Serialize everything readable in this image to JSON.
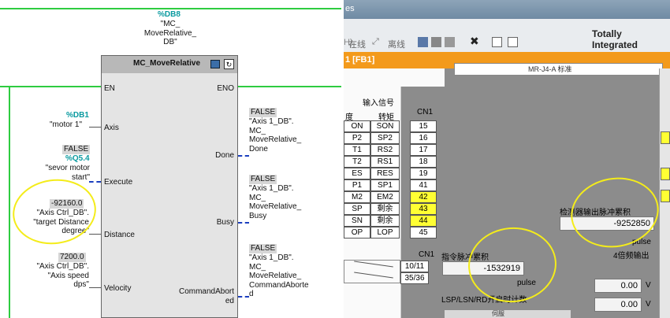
{
  "ladder": {
    "db_tag": "%DB8",
    "db_name": "\"MC_\nMoveRelative_\nDB\"",
    "block_title": "MC_MoveRelative",
    "pins": {
      "en": "EN",
      "eno": "ENO",
      "axis": "Axis",
      "execute": "Execute",
      "distance": "Distance",
      "velocity": "Velocity",
      "done": "Done",
      "busy": "Busy",
      "cmd_aborted": "CommandAbort\ned"
    },
    "axis_param": {
      "tag": "%DB1",
      "name": "\"motor 1\""
    },
    "execute_param": {
      "value": "FALSE",
      "tag": "%Q5.4",
      "name": "\"sevor motor\nstart\""
    },
    "distance_param": {
      "value": "-92160.0",
      "name": "\"Axis Ctrl_DB\".\n\"target Distance\ndegree\""
    },
    "velocity_param": {
      "value": "7200.0",
      "name": "\"Axis Ctrl_DB\".\n\"Axis speed\ndps\""
    },
    "done_out": {
      "value": "FALSE",
      "name": "\"Axis 1_DB\".\nMC_\nMoveRelative_\nDone"
    },
    "busy_out": {
      "value": "FALSE",
      "name": "\"Axis 1_DB\".\nMC_\nMoveRelative_\nBusy"
    },
    "aborted_out": {
      "value": "FALSE",
      "name": "\"Axis 1_DB\".\nMC_\nMoveRelative_\nCommandAborte\nd"
    }
  },
  "tia": {
    "title_fragment": "es",
    "toolbar_online": "在线",
    "toolbar_offline": "离线",
    "brand": "Totally Integrated",
    "fb_tab": "1 [FB1]",
    "panel_caption": "MR-J4-A 标准",
    "input_signal_header": "输入信号",
    "col_a_header": "度",
    "col_b_header": "转矩",
    "col_c_header": "CN1",
    "rows": [
      {
        "a": "ON",
        "b": "SON",
        "c": "15",
        "hl": false
      },
      {
        "a": "P2",
        "b": "SP2",
        "c": "16",
        "hl": false
      },
      {
        "a": "T1",
        "b": "RS2",
        "c": "17",
        "hl": false
      },
      {
        "a": "T2",
        "b": "RS1",
        "c": "18",
        "hl": false
      },
      {
        "a": "ES",
        "b": "RES",
        "c": "19",
        "hl": false
      },
      {
        "a": "P1",
        "b": "SP1",
        "c": "41",
        "hl": false
      },
      {
        "a": "M2",
        "b": "EM2",
        "c": "42",
        "hl": true
      },
      {
        "a": "SP",
        "b": "剩余",
        "c": "43",
        "hl": true
      },
      {
        "a": "SN",
        "b": "剩余",
        "c": "44",
        "hl": true
      },
      {
        "a": "OP",
        "b": "LOP",
        "c": "45",
        "hl": false
      }
    ],
    "cn1_label_2": "CN1",
    "pin_10_11": "10/11",
    "pin_35_36": "35/36",
    "cmd_pulse_label": "指令脉冲累积",
    "cmd_pulse_value": "-1532919",
    "pulse_unit": "pulse",
    "lsp_label": "LSP/LSN/RD开启时计数",
    "enc_pulse_label": "检测器输出脉冲累积",
    "enc_pulse_value": "-9252850",
    "enc_pulse_unit": "pulse",
    "x4_label": "4倍频输出",
    "v1_value": "0.00",
    "v_unit": "V",
    "v2_value": "0.00",
    "bottom_fragment": "伺服"
  }
}
